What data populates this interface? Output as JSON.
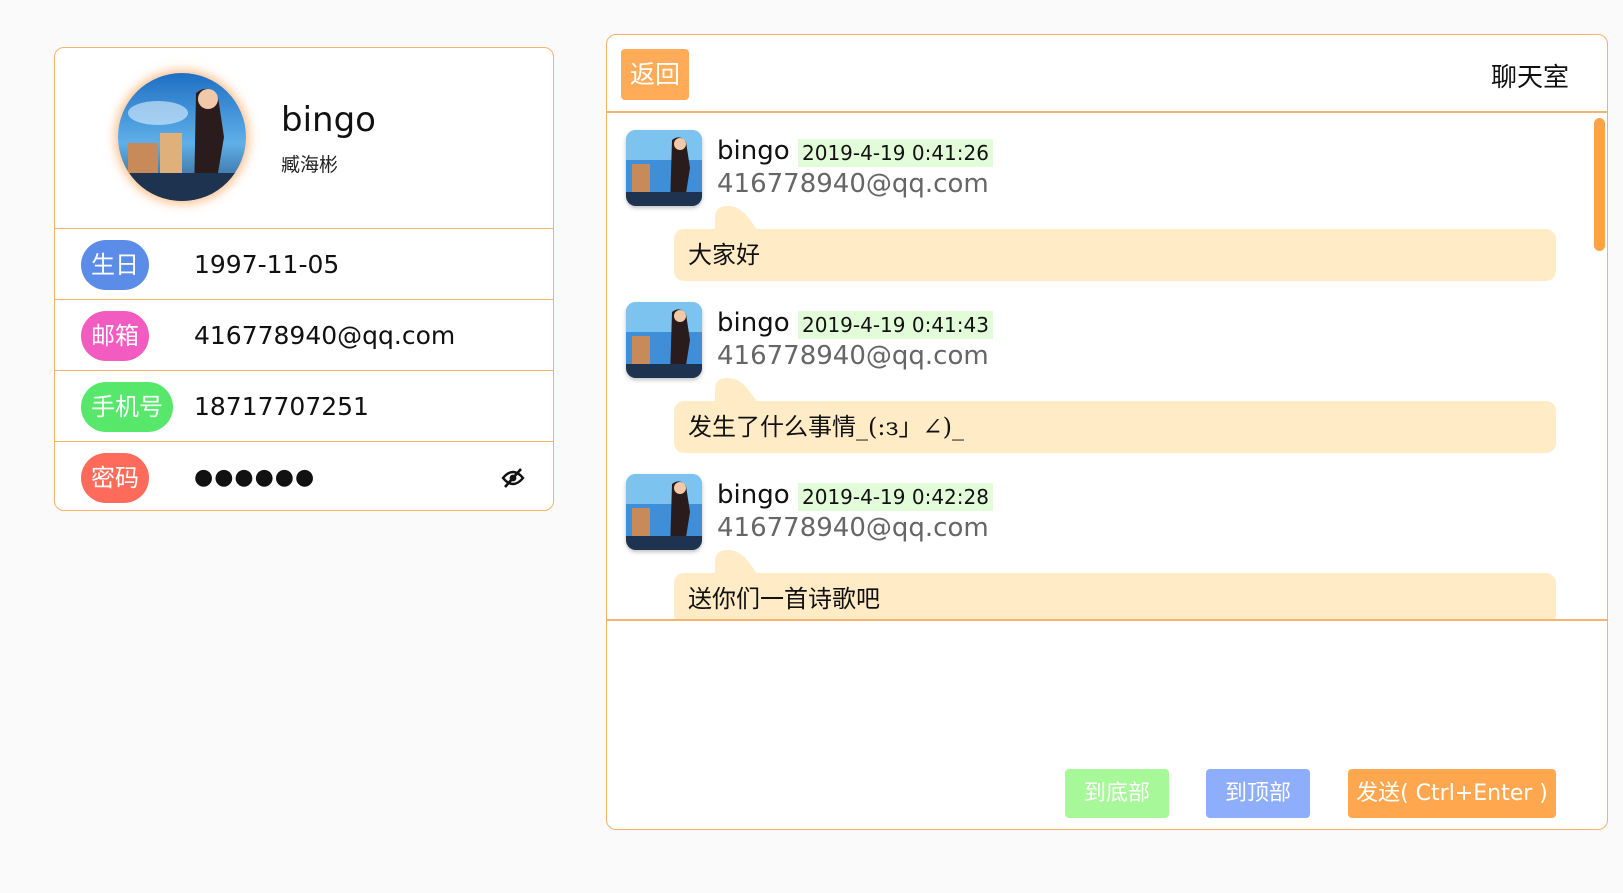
{
  "profile": {
    "username": "bingo",
    "real_name": "臧海彬",
    "fields": [
      {
        "label": "生日",
        "value": "1997-11-05",
        "color": "#5b8de8"
      },
      {
        "label": "邮箱",
        "value": "416778940@qq.com",
        "color": "#f25bbf"
      },
      {
        "label": "手机号",
        "value": "18717707251",
        "color": "#57e86b"
      },
      {
        "label": "密码",
        "value": "●●●●●●",
        "color": "#ff6b5a"
      }
    ],
    "password_toggle_icon": "eye-off-icon"
  },
  "chat": {
    "back_label": "返回",
    "title": "聊天室",
    "messages": [
      {
        "user": "bingo",
        "time": "2019-4-19 0:41:26",
        "email": "416778940@qq.com",
        "text": "大家好"
      },
      {
        "user": "bingo",
        "time": "2019-4-19 0:41:43",
        "email": "416778940@qq.com",
        "text": "发生了什么事情_(:з」∠)_"
      },
      {
        "user": "bingo",
        "time": "2019-4-19 0:42:28",
        "email": "416778940@qq.com",
        "text": "送你们一首诗歌吧"
      }
    ],
    "buttons": {
      "to_bottom": "到底部",
      "to_top": "到顶部",
      "send": "发送( Ctrl+Enter )"
    }
  },
  "colors": {
    "accent": "#ffab58",
    "border": "#f6b36b",
    "bubble": "#ffecc6",
    "timestamp_bg": "#e2fbd8"
  }
}
